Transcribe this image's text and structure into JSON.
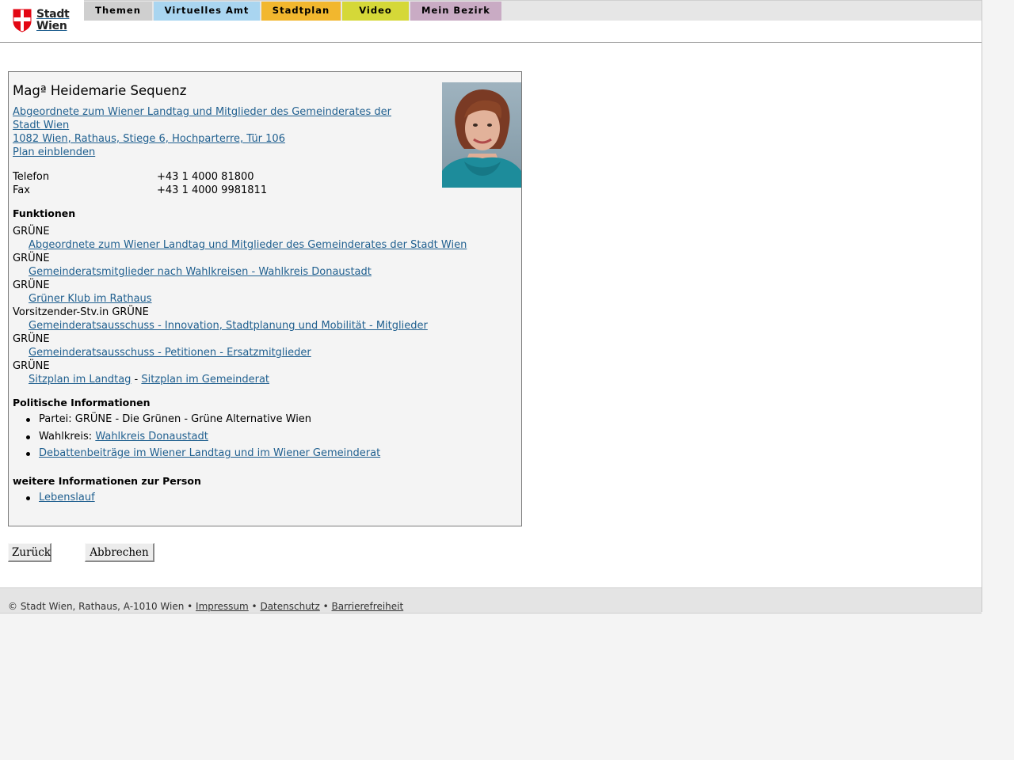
{
  "header": {
    "logo_line1": "Stadt",
    "logo_line2": "Wien",
    "tabs": [
      "Themen",
      "Virtuelles Amt",
      "Stadtplan",
      "Video",
      "Mein Bezirk"
    ]
  },
  "person": {
    "name": "Magª Heidemarie Sequenz",
    "role": "Abgeordnete zum Wiener Landtag und Mitglieder des Gemeinderates der Stadt Wien ",
    "address": "1082 Wien, Rathaus, Stiege 6, Hochparterre, Tür 106",
    "plan_link": "Plan einblenden",
    "phone_label": "Telefon",
    "phone": "+43 1 4000 81800",
    "fax_label": "Fax",
    "fax": "+43 1 4000 9981811"
  },
  "functions": {
    "heading": "Funktionen",
    "items": [
      {
        "party": "GRÜNE",
        "link": "Abgeordnete zum Wiener Landtag und Mitglieder des Gemeinderates der Stadt Wien"
      },
      {
        "party": "GRÜNE",
        "link": "Gemeinderatsmitglieder nach Wahlkreisen - Wahlkreis Donaustadt"
      },
      {
        "party": "GRÜNE",
        "link": "Grüner Klub im Rathaus"
      },
      {
        "party": "Vorsitzender-Stv.in GRÜNE",
        "link": "Gemeinderatsausschuss - Innovation, Stadtplanung und Mobilität - Mitglieder"
      },
      {
        "party": "GRÜNE",
        "link": "Gemeinderatsausschuss - Petitionen - Ersatzmitglieder"
      },
      {
        "party": "GRÜNE",
        "link": "Sitzplan im Landtag",
        "separator": " - ",
        "link2": "Sitzplan im Gemeinderat"
      }
    ]
  },
  "political": {
    "heading": "Politische Informationen",
    "party_text": "Partei: GRÜNE - Die Grünen - Grüne Alternative Wien",
    "district_label": "Wahlkreis: ",
    "district_link": "Wahlkreis Donaustadt",
    "debates_link": "Debattenbeiträge im Wiener Landtag und im Wiener Gemeinderat"
  },
  "further": {
    "heading": "weitere Informationen zur Person",
    "cv_link": "Lebenslauf"
  },
  "buttons": {
    "back": "Zurück",
    "cancel": "Abbrechen"
  },
  "footer": {
    "copyright": "© Stadt Wien, Rathaus, A-1010 Wien",
    "sep": " • ",
    "links": [
      "Impressum",
      "Datenschutz",
      "Barrierefreiheit"
    ]
  },
  "colors": {
    "tab_themen": "#cfcfcf",
    "tab_virtuelles_amt": "#a9d5f0",
    "tab_stadtplan": "#f2b72e",
    "tab_video": "#d5d838",
    "tab_mein_bezirk": "#c9abc4",
    "link": "#1f5f8f",
    "logo_red": "#e30613"
  }
}
